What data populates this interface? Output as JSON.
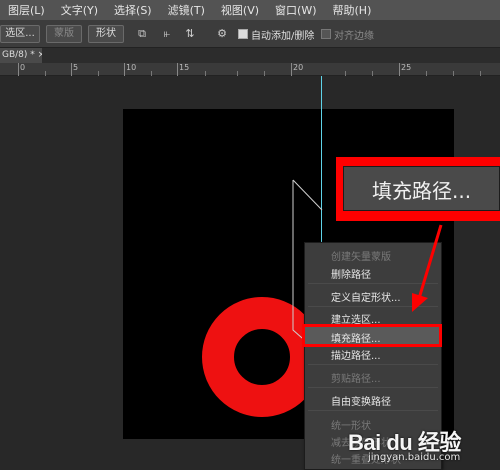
{
  "menubar": {
    "items": [
      "图层(L)",
      "文字(Y)",
      "选择(S)",
      "滤镜(T)",
      "视图(V)",
      "窗口(W)",
      "帮助(H)"
    ]
  },
  "options": {
    "selection_btn": "选区...",
    "mask_btn": "蒙版",
    "shape_btn": "形状",
    "auto_add_delete": "自动添加/删除",
    "align_edges": "对齐边缘",
    "auto_add_delete_checked": true,
    "align_edges_checked": false
  },
  "tab": {
    "label": "GB/8) *",
    "close": "×"
  },
  "ruler": {
    "labels": [
      "0",
      "5",
      "10",
      "15",
      "20",
      "25"
    ]
  },
  "context_menu": {
    "items": [
      {
        "label": "创建矢量蒙版",
        "enabled": false
      },
      {
        "label": "删除路径",
        "enabled": true
      },
      {
        "label": "定义自定形状...",
        "enabled": true
      },
      {
        "label": "建立选区...",
        "enabled": true
      },
      {
        "label": "填充路径...",
        "enabled": true,
        "highlighted": true
      },
      {
        "label": "描边路径...",
        "enabled": true
      },
      {
        "label": "剪贴路径...",
        "enabled": false
      },
      {
        "label": "自由变换路径",
        "enabled": true
      },
      {
        "label": "统一形状",
        "enabled": false
      },
      {
        "label": "减去顶层形状",
        "enabled": false
      },
      {
        "label": "统一重叠处形状",
        "enabled": false
      }
    ]
  },
  "callout": {
    "label": "填充路径..."
  },
  "colors": {
    "highlight": "#ff0000",
    "ring": "#ee1111",
    "guide": "#5fd3e8"
  },
  "watermark": {
    "main": "Bai du 经验",
    "sub": "jingyan.baidu.com"
  }
}
